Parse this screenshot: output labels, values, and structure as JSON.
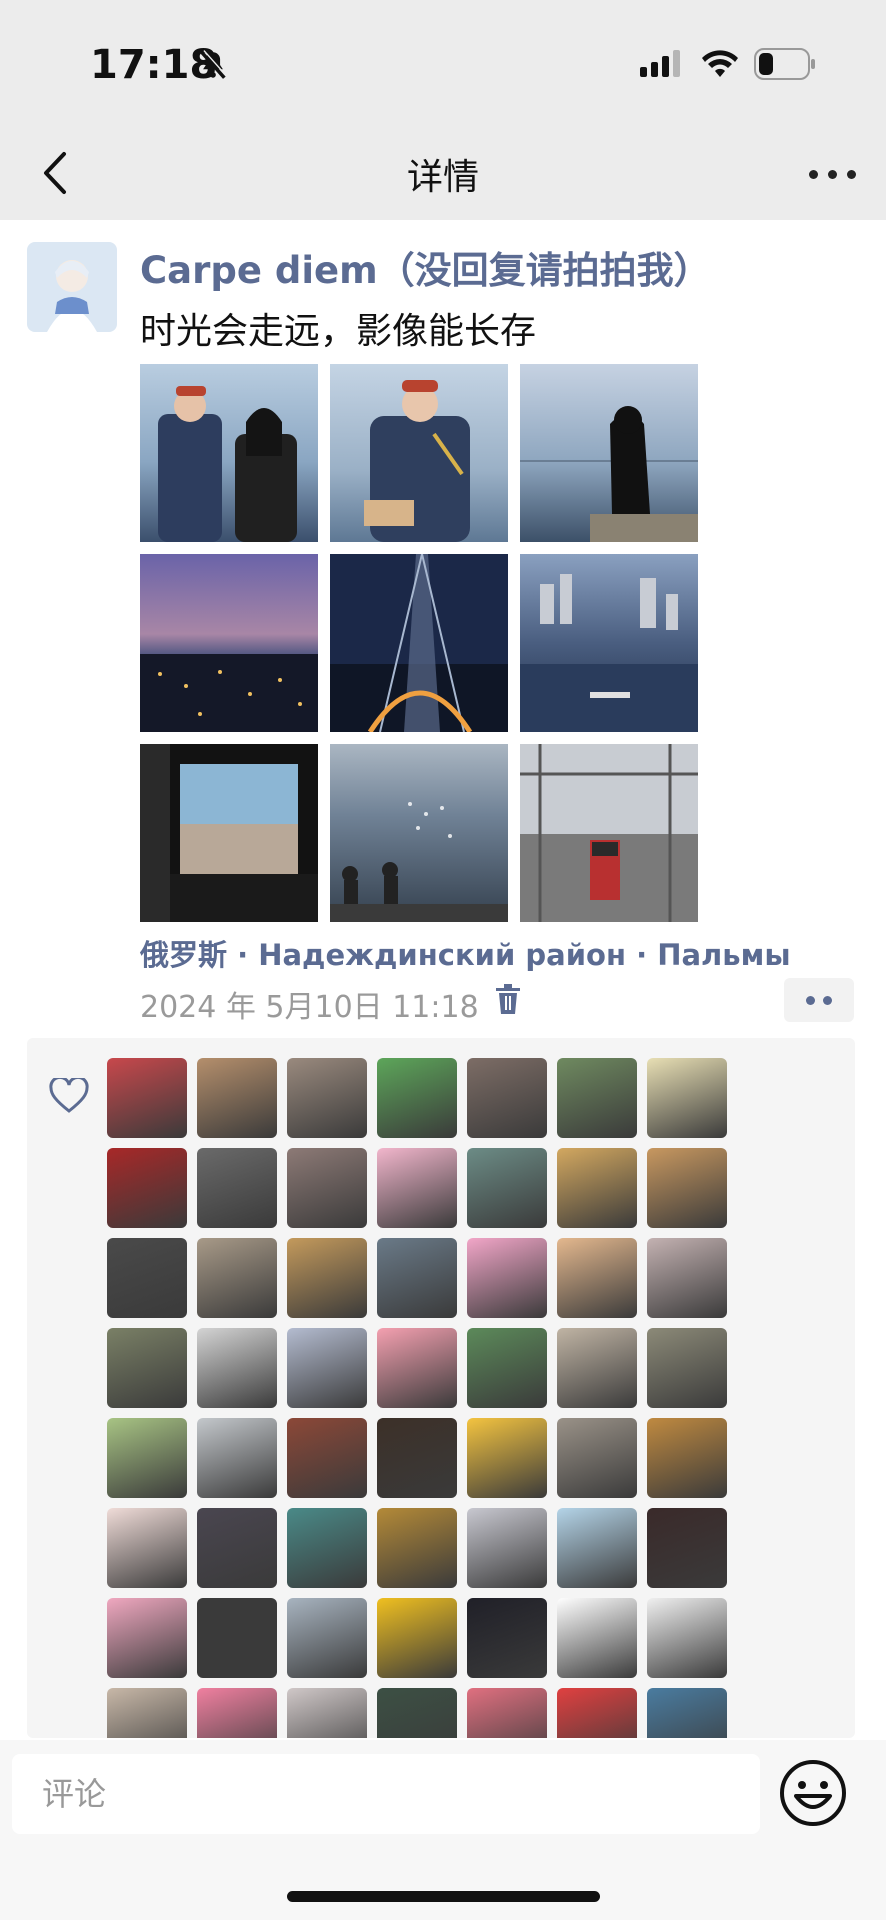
{
  "status_bar": {
    "time": "17:18"
  },
  "nav": {
    "title": "详情"
  },
  "post": {
    "username": "Carpe diem（没回复请拍拍我）",
    "text": "时光会走远，影像能长存",
    "photos": [
      {
        "name": "couple-sea",
        "colors": [
          "#aac0d4",
          "#3a4a66"
        ]
      },
      {
        "name": "soldier-sea",
        "colors": [
          "#b7cbe0",
          "#2f4060"
        ]
      },
      {
        "name": "girl-sea",
        "colors": [
          "#9fb4cc",
          "#3a4d66"
        ]
      },
      {
        "name": "city-dusk",
        "colors": [
          "#5b4c86",
          "#1a1c34"
        ]
      },
      {
        "name": "bridge-night",
        "colors": [
          "#1d2e54",
          "#0e1525"
        ]
      },
      {
        "name": "harbor-city",
        "colors": [
          "#6e86a6",
          "#1e2c44"
        ]
      },
      {
        "name": "window-view",
        "colors": [
          "#8fb8d0",
          "#151515"
        ]
      },
      {
        "name": "sea-sparkle",
        "colors": [
          "#7b8ea3",
          "#2a3442"
        ]
      },
      {
        "name": "railway-station",
        "colors": [
          "#c9ced6",
          "#6a6a6a"
        ]
      }
    ],
    "location": "俄罗斯 · Надеждинский район · Пальмы",
    "date": "2024 年 5月10日 11:18"
  },
  "likes": {
    "avatars": [
      "#c8484c",
      "#b58f6c",
      "#9a8a7e",
      "#5da65a",
      "#7d6d66",
      "#6f8a60",
      "#e8dfb4",
      "#a82828",
      "#6a6a6a",
      "#8d7a76",
      "#f2b6cc",
      "#6c8c86",
      "#d3a860",
      "#c89860",
      "#4a4a4a",
      "#a89a88",
      "#c49a5c",
      "#6a7a88",
      "#f2a6c8",
      "#e4b88e",
      "#c4b2b2",
      "#7a8066",
      "#d4d4d4",
      "#b4bcd0",
      "#f4a0b0",
      "#5c8a5a",
      "#c0b4a4",
      "#8c8a78",
      "#a8c484",
      "#c4c8cc",
      "#8c4838",
      "#3c3028",
      "#f4c440",
      "#9a9288",
      "#c08a40",
      "#f0dcd8",
      "#4a4650",
      "#4a8a88",
      "#b48a38",
      "#c8c8d0",
      "#b4d4e8",
      "#3a2a2a",
      "#f0a8c0",
      "#3a3a3a",
      "#a8b4c0",
      "#f0c020",
      "#202028",
      "#ffffff",
      "#f0f0f0",
      "#c8b8a8",
      "#f080a0",
      "#d0c8c8",
      "#3c5044",
      "#e07080",
      "#e04040",
      "#4a7ca0"
    ]
  },
  "comment": {
    "placeholder": "评论"
  }
}
